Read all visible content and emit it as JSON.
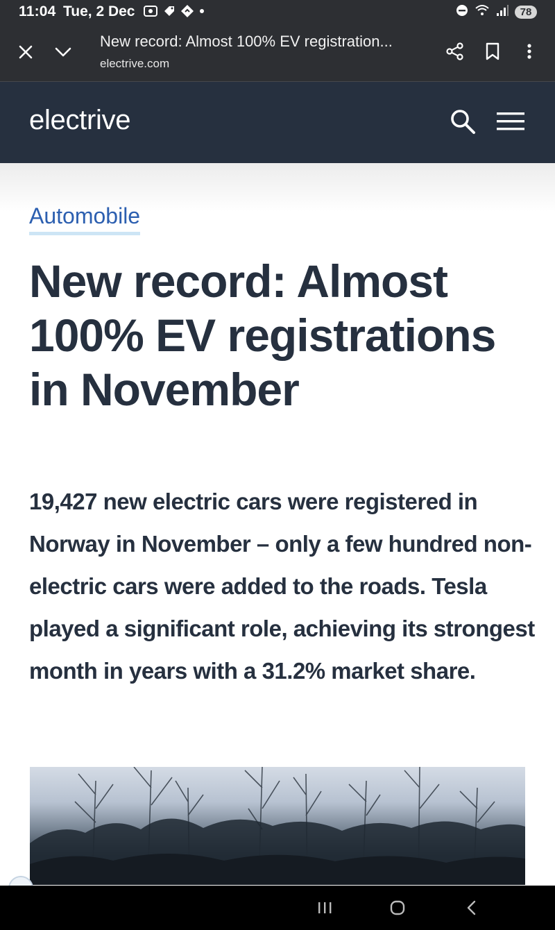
{
  "status_bar": {
    "time": "11:04",
    "date": "Tue, 2 Dec",
    "battery": "78",
    "notification_icons": [
      "screenshot-icon",
      "tag-icon",
      "location-diamond-icon",
      "dot-icon"
    ],
    "system_icons": [
      "do-not-disturb-icon",
      "wifi-icon",
      "signal-icon"
    ]
  },
  "tab_bar": {
    "title": "New record: Almost 100% EV registration...",
    "url": "electrive.com"
  },
  "site": {
    "logo": "electrive"
  },
  "article": {
    "category": "Automobile",
    "headline": "New record: Almost 100% EV registrations in November",
    "lead": "19,427 new electric cars were registered in Norway in November – only a few hundred non-electric cars were added to the roads. Tesla played a significant role, achieving its strongest month in years with a 31.2% market share."
  },
  "colors": {
    "status_bg": "#2d2f33",
    "header_bg": "#26303f",
    "category_link": "#2c5fb0",
    "category_underline": "#cde5f5",
    "text_dark": "#26303f"
  }
}
